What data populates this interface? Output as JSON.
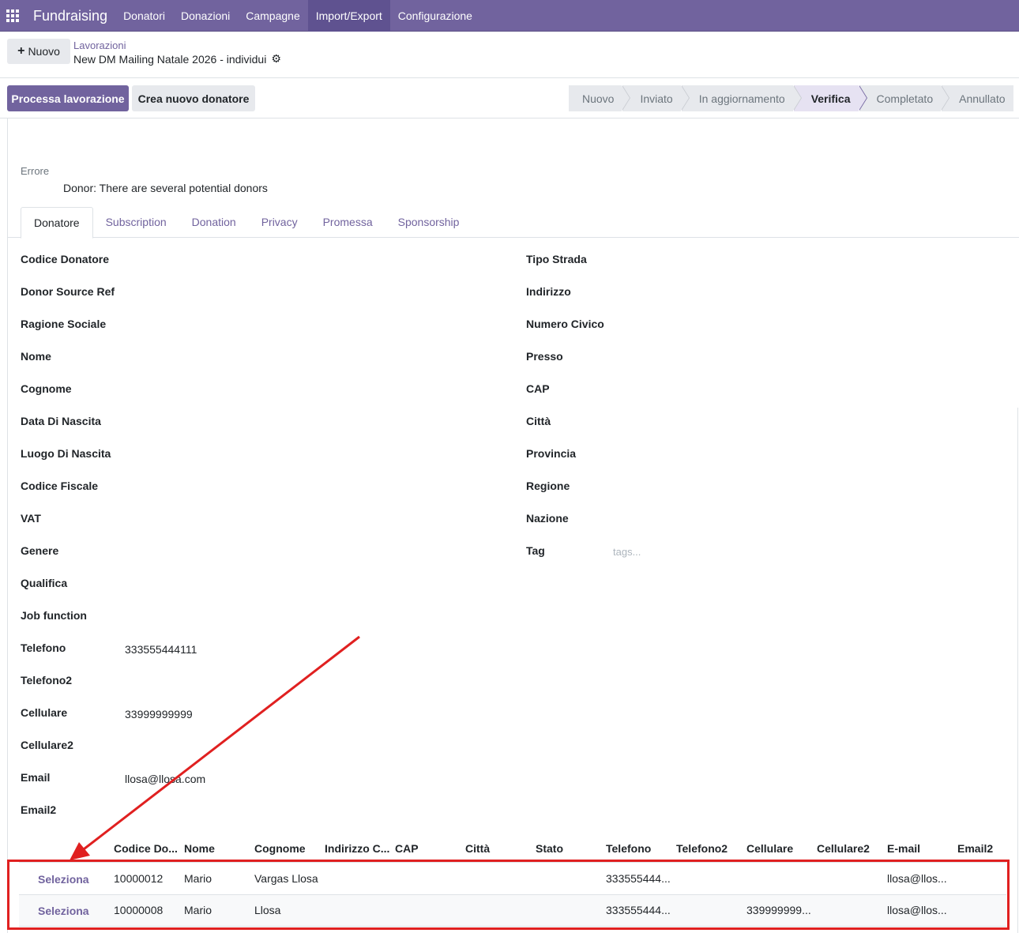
{
  "navbar": {
    "brand": "Fundraising",
    "menu": [
      "Donatori",
      "Donazioni",
      "Campagne",
      "Import/Export",
      "Configurazione"
    ],
    "active_index": 3,
    "accent_color": "#71639e"
  },
  "control_panel": {
    "new_button": "Nuovo",
    "breadcrumb_parent": "Lavorazioni",
    "record_title": "New DM Mailing Natale 2026 - individui"
  },
  "actions": {
    "process": "Processa lavorazione",
    "create_donor": "Crea nuovo donatore"
  },
  "statusbar": {
    "stages": [
      "Nuovo",
      "Inviato",
      "In aggiornamento",
      "Verifica",
      "Completato",
      "Annullato"
    ],
    "current": "Verifica"
  },
  "error": {
    "label": "Errore",
    "message": "Donor: There are several potential donors"
  },
  "tabs": [
    "Donatore",
    "Subscription",
    "Donation",
    "Privacy",
    "Promessa",
    "Sponsorship"
  ],
  "active_tab": "Donatore",
  "left_fields": [
    {
      "label": "Codice Donatore",
      "value": ""
    },
    {
      "label": "Donor Source Ref",
      "value": ""
    },
    {
      "label": "Ragione Sociale",
      "value": ""
    },
    {
      "label": "Nome",
      "value": ""
    },
    {
      "label": "Cognome",
      "value": ""
    },
    {
      "label": "Data Di Nascita",
      "value": ""
    },
    {
      "label": "Luogo Di Nascita",
      "value": ""
    },
    {
      "label": "Codice Fiscale",
      "value": ""
    },
    {
      "label": "VAT",
      "value": ""
    },
    {
      "label": "Genere",
      "value": ""
    },
    {
      "label": "Qualifica",
      "value": ""
    },
    {
      "label": "Job function",
      "value": ""
    },
    {
      "label": "Telefono",
      "value": "333555444111"
    },
    {
      "label": "Telefono2",
      "value": ""
    },
    {
      "label": "Cellulare",
      "value": "33999999999"
    },
    {
      "label": "Cellulare2",
      "value": ""
    },
    {
      "label": "Email",
      "value": "llosa@llosa.com"
    },
    {
      "label": "Email2",
      "value": ""
    }
  ],
  "right_fields": [
    {
      "label": "Tipo Strada",
      "value": ""
    },
    {
      "label": "Indirizzo",
      "value": ""
    },
    {
      "label": "Numero Civico",
      "value": ""
    },
    {
      "label": "Presso",
      "value": ""
    },
    {
      "label": "CAP",
      "value": ""
    },
    {
      "label": "Città",
      "value": ""
    },
    {
      "label": "Provincia",
      "value": ""
    },
    {
      "label": "Regione",
      "value": ""
    },
    {
      "label": "Nazione",
      "value": ""
    },
    {
      "label": "Tag",
      "value": ""
    }
  ],
  "tags_placeholder": "tags...",
  "table": {
    "columns": [
      "Codice Do...",
      "Nome",
      "Cognome",
      "Indirizzo C...",
      "CAP",
      "Città",
      "Stato",
      "Telefono",
      "Telefono2",
      "Cellulare",
      "Cellulare2",
      "E-mail",
      "Email2"
    ],
    "select_label": "Seleziona",
    "rows": [
      {
        "code": "10000012",
        "nome": "Mario",
        "cognome": "Vargas Llosa",
        "telefono": "333555444...",
        "cellulare": "",
        "email": "llosa@llos..."
      },
      {
        "code": "10000008",
        "nome": "Mario",
        "cognome": "Llosa",
        "telefono": "333555444...",
        "cellulare": "339999999...",
        "email": "llosa@llos..."
      }
    ]
  },
  "annotation_color": "#e02020"
}
